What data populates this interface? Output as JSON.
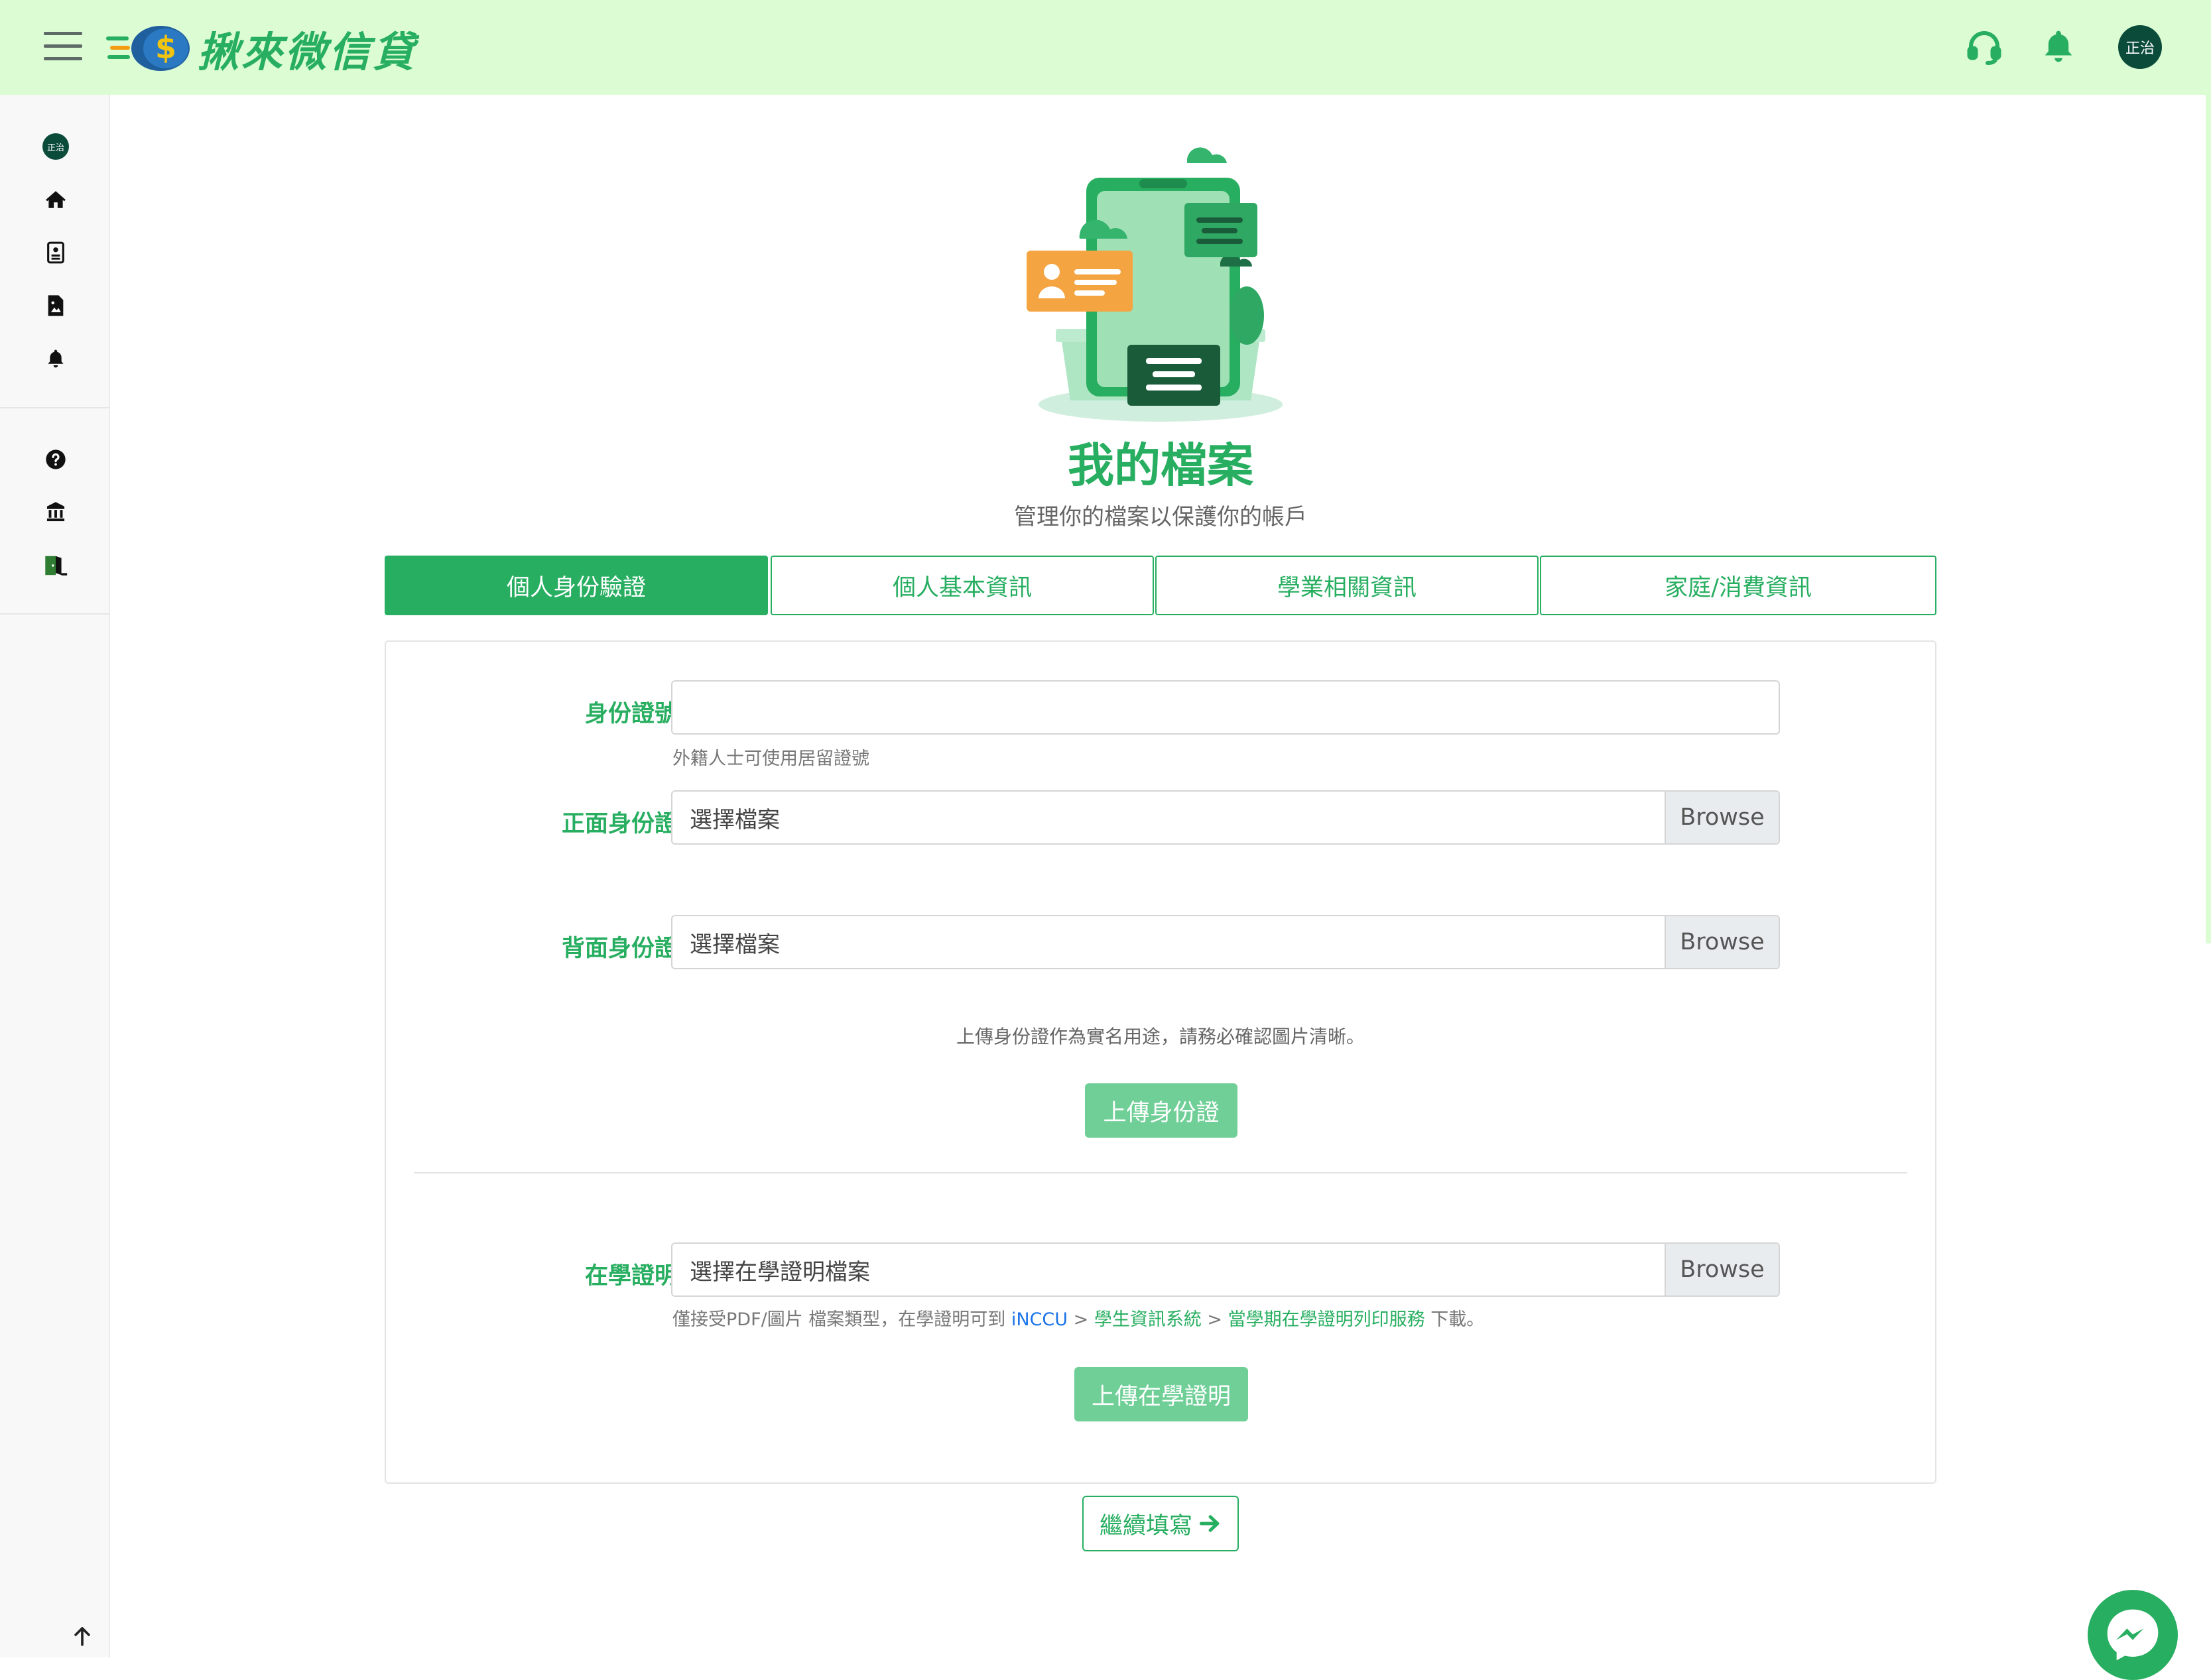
{
  "app": {
    "name": "揪來微信貸",
    "user_initials": "正治",
    "colors": {
      "accent": "#27ae60",
      "topbar": "#dcfcd4",
      "avatar": "#0b4b3a",
      "upload_button": "#6fcf97"
    }
  },
  "header": {
    "menu_icon": "hamburger-icon",
    "icons": [
      "headset-icon",
      "bell-icon"
    ]
  },
  "sidebar": {
    "items": [
      {
        "icon": "avatar",
        "label": "正治"
      },
      {
        "icon": "home-icon"
      },
      {
        "icon": "id-card-icon"
      },
      {
        "icon": "document-image-icon"
      },
      {
        "icon": "bell-icon"
      },
      {
        "icon": "question-circle-icon"
      },
      {
        "icon": "bank-icon"
      },
      {
        "icon": "logout-door-icon"
      }
    ]
  },
  "page": {
    "title": "我的檔案",
    "subtitle": "管理你的檔案以保護你的帳戶"
  },
  "tabs": [
    {
      "label": "個人身份驗證",
      "active": true
    },
    {
      "label": "個人基本資訊",
      "active": false
    },
    {
      "label": "學業相關資訊",
      "active": false
    },
    {
      "label": "家庭/消費資訊",
      "active": false
    }
  ],
  "form": {
    "id_number": {
      "label": "身份證號",
      "value": "",
      "help": "外籍人士可使用居留證號"
    },
    "id_front": {
      "label": "正面身份證",
      "placeholder": "選擇檔案",
      "browse": "Browse"
    },
    "id_back": {
      "label": "背面身份證",
      "placeholder": "選擇檔案",
      "browse": "Browse"
    },
    "id_note": "上傳身份證作為實名用途，請務必確認圖片清晰。",
    "upload_id_button": "上傳身份證",
    "enrollment": {
      "label": "在學證明",
      "placeholder": "選擇在學證明檔案",
      "browse": "Browse",
      "help_prefix": "僅接受PDF/圖片 檔案類型，在學證明可到 ",
      "help_link1": "iNCCU",
      "help_sep1": " > ",
      "help_link2": "學生資訊系統",
      "help_sep2": " > ",
      "help_link3": "當學期在學證明列印服務",
      "help_suffix": " 下載。"
    },
    "upload_enrollment_button": "上傳在學證明",
    "continue_button": "繼續填寫"
  }
}
